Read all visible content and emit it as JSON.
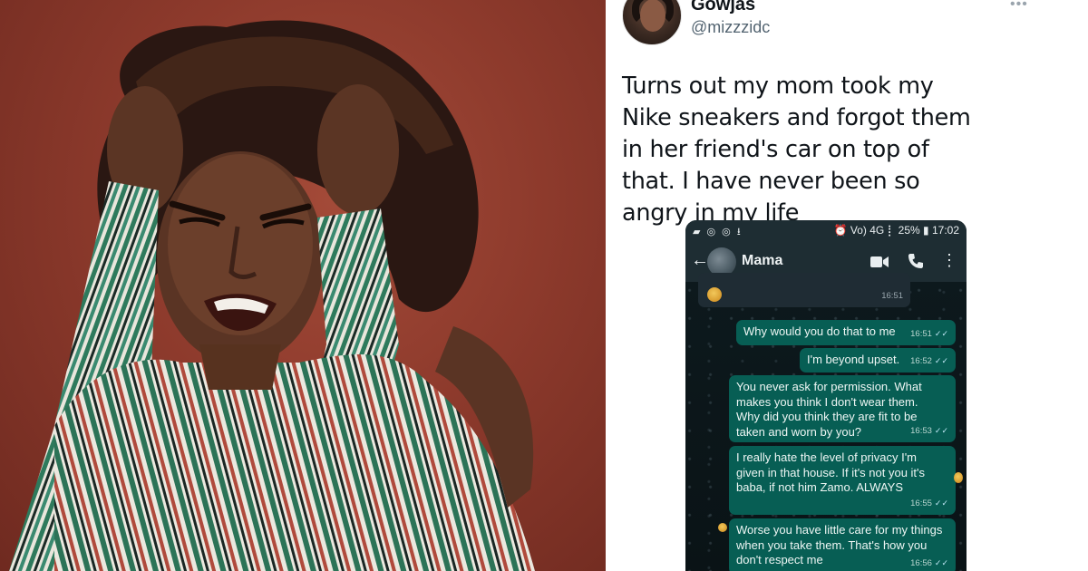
{
  "tweet": {
    "display_name": "Gowjas",
    "handle": "@mizzzidc",
    "more_icon": "more-horizontal-icon",
    "text": "Turns out my mom took my Nike sneakers and forgot them in her friend's car on top of that. I have never been so angry in my life"
  },
  "phone": {
    "status_left": "▰ ◎ ◎ ⭳",
    "status_right": "⏰ Vo) 4G ⡇ 25% ▮ 17:02",
    "contact_name": "Mama",
    "icons": [
      "back-arrow-icon",
      "video-call-icon",
      "phone-call-icon",
      "overflow-menu-icon"
    ]
  },
  "messages": [
    {
      "id": "m0",
      "direction": "in",
      "text": "",
      "time": "16:51"
    },
    {
      "id": "m1",
      "direction": "out",
      "text": "Why would you do that to me",
      "time": "16:51"
    },
    {
      "id": "m2",
      "direction": "out",
      "text": "I'm beyond upset.",
      "time": "16:52"
    },
    {
      "id": "m3",
      "direction": "out",
      "text": "You never ask for permission. What makes you think I don't wear them. Why did you think they are fit to be taken and worn by you?",
      "time": "16:53"
    },
    {
      "id": "m4",
      "direction": "out",
      "text": "I really hate the level of privacy I'm given in that house. If it's not you it's baba, if not him Zamo. ALWAYS",
      "time": "16:55"
    },
    {
      "id": "m5",
      "direction": "out",
      "text": "Worse you have little care for my things when you take them. That's how you don't respect me",
      "time": "16:56"
    }
  ],
  "colors": {
    "backdrop": "#8d3a2c",
    "outgoing_bubble": "#075e54",
    "incoming_bubble": "#1f2c34",
    "app_bar": "#1e2d33",
    "read_ticks": "#bfe7f5"
  }
}
